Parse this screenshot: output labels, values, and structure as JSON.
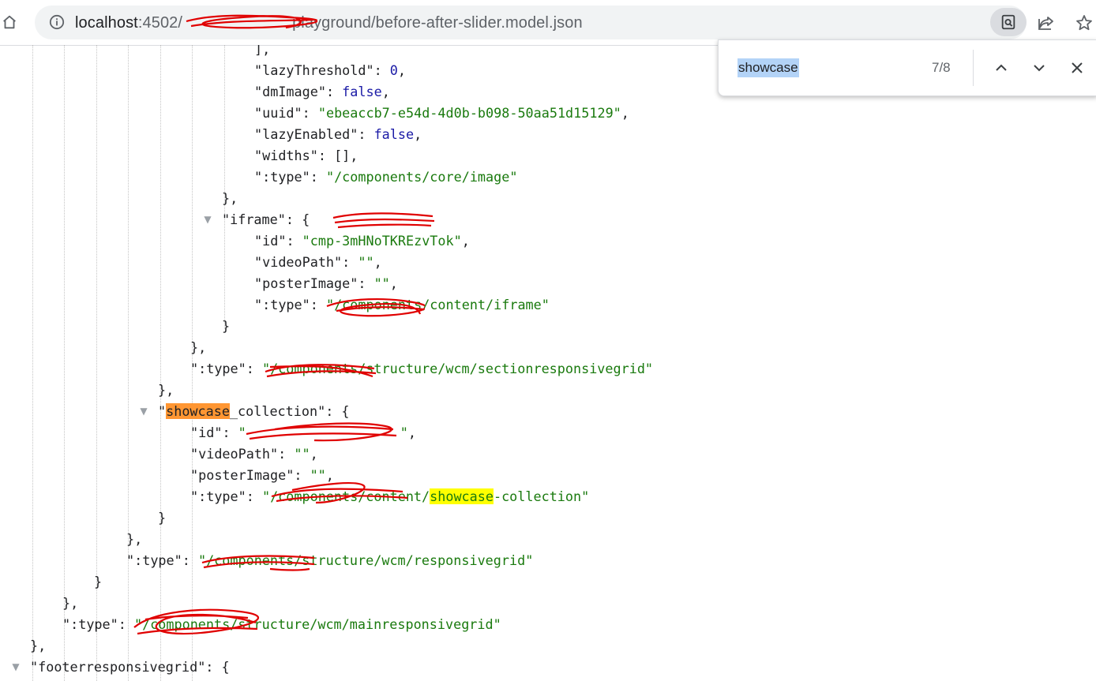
{
  "browser": {
    "url_host": "localhost",
    "url_port": ":4502/",
    "url_path": "playground/before-after-slider.model.json"
  },
  "find_bar": {
    "query": "showcase",
    "count": "7/8"
  },
  "icons": {
    "home": "home-icon",
    "info": "info-icon",
    "zoom": "search-page-icon",
    "share": "share-icon",
    "star": "star-icon",
    "prev": "chevron-up-icon",
    "next": "chevron-down-icon",
    "close": "close-icon"
  },
  "colors": {
    "json_string": "#1a7a0e",
    "json_keyword": "#1a1aa6",
    "active_match": "#ff9632",
    "match": "#ffff00",
    "redaction": "#e00000"
  },
  "json_lines": [
    {
      "text": "],"
    },
    {
      "key": "lazyThreshold",
      "value": "0",
      "type": "number",
      "trail": ","
    },
    {
      "key": "dmImage",
      "value": "false",
      "type": "bool",
      "trail": ","
    },
    {
      "key": "uuid",
      "value": "\"ebeaccb7-e54d-4d0b-b098-50aa51d15129\"",
      "type": "string",
      "trail": ","
    },
    {
      "key": "lazyEnabled",
      "value": "false",
      "type": "bool",
      "trail": ","
    },
    {
      "key": "widths",
      "value": "[]",
      "type": "plain",
      "trail": ","
    },
    {
      "key": ":type",
      "value": "\"/components/core/image\"",
      "type": "string",
      "trail": ""
    },
    {
      "text": "},"
    },
    {
      "key": "iframe",
      "value": "{",
      "type": "plain",
      "trail": ""
    },
    {
      "key": "id",
      "value": "\"cmp-3mHNoTKREzvTok\"",
      "type": "string",
      "trail": ","
    },
    {
      "key": "videoPath",
      "value": "\"\"",
      "type": "string",
      "trail": ","
    },
    {
      "key": "posterImage",
      "value": "\"\"",
      "type": "string",
      "trail": ","
    },
    {
      "key": ":type",
      "value": "\"/components/content/iframe\"",
      "type": "string",
      "trail": ""
    },
    {
      "text": "}"
    },
    {
      "text": "},"
    },
    {
      "key": ":type",
      "value": "\"/components/structure/wcm/sectionresponsivegrid\"",
      "type": "string",
      "trail": ""
    },
    {
      "text": "},"
    },
    {
      "key_hl": "showcase",
      "key_rest": "_collection",
      "value": "{",
      "type": "plain",
      "trail": ""
    },
    {
      "key": "id",
      "value": "\"cmp-\"",
      "type": "string",
      "trail": ","
    },
    {
      "key": "videoPath",
      "value": "\"\"",
      "type": "string",
      "trail": ","
    },
    {
      "key": "posterImage",
      "value": "\"\"",
      "type": "string",
      "trail": ","
    },
    {
      "key": ":type",
      "value_pre": "\"/components/content/",
      "value_hl": "showcase",
      "value_post": "-collection\"",
      "type": "string",
      "trail": ""
    },
    {
      "text": "}"
    },
    {
      "text": "},"
    },
    {
      "key": ":type",
      "value": "\"/components/structure/wcm/responsivegrid\"",
      "type": "string",
      "trail": ""
    },
    {
      "text": "}"
    },
    {
      "text": "},"
    },
    {
      "key": ":type",
      "value": "\"/components/structure/wcm/mainresponsivegrid\"",
      "type": "string",
      "trail": ""
    },
    {
      "text": "},"
    },
    {
      "key": "footerresponsivegrid",
      "value": "{",
      "type": "plain",
      "trail": ""
    }
  ]
}
